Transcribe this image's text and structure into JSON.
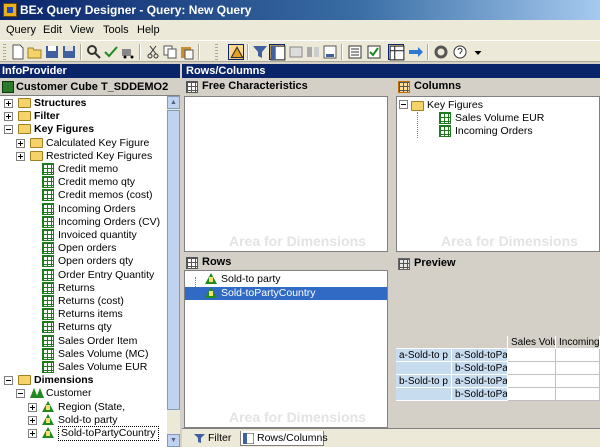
{
  "window": {
    "title": "BEx Query Designer - Query: New Query"
  },
  "menu": [
    "Query",
    "Edit",
    "View",
    "Tools",
    "Help"
  ],
  "toolbar": {
    "icons": [
      "new-icon",
      "open-icon",
      "save-icon",
      "print-icon",
      "cut-icon",
      "copy-icon",
      "paste-icon",
      "filter-icon",
      "rows-columns-icon",
      "properties-icon",
      "help-icon"
    ]
  },
  "left": {
    "header": "InfoProvider",
    "cube": "Customer Cube T_SDDEMO2",
    "tree": [
      {
        "label": "Structures",
        "kind": "folder",
        "bold": true,
        "expander": "plus"
      },
      {
        "label": "Filter",
        "kind": "folder",
        "bold": true,
        "expander": "plus"
      },
      {
        "label": "Key Figures",
        "kind": "folder",
        "bold": true,
        "expander": "minus"
      },
      {
        "label": "Calculated Key Figure",
        "kind": "folder",
        "expander": "plus"
      },
      {
        "label": "Restricted Key Figures",
        "kind": "folder",
        "expander": "plus"
      },
      {
        "label": "Credit memo",
        "kind": "kf"
      },
      {
        "label": "Credit memo qty",
        "kind": "kf"
      },
      {
        "label": "Credit memos (cost)",
        "kind": "kf"
      },
      {
        "label": "Incoming Orders",
        "kind": "kf"
      },
      {
        "label": "Incoming Orders (CV)",
        "kind": "kf"
      },
      {
        "label": "Invoiced quantity",
        "kind": "kf"
      },
      {
        "label": "Open orders",
        "kind": "kf"
      },
      {
        "label": "Open orders qty",
        "kind": "kf"
      },
      {
        "label": "Order Entry Quantity",
        "kind": "kf"
      },
      {
        "label": "Returns",
        "kind": "kf"
      },
      {
        "label": "Returns (cost)",
        "kind": "kf"
      },
      {
        "label": "Returns items",
        "kind": "kf"
      },
      {
        "label": "Returns qty",
        "kind": "kf"
      },
      {
        "label": "Sales Order Item",
        "kind": "kf"
      },
      {
        "label": "Sales Volume (MC)",
        "kind": "kf"
      },
      {
        "label": "Sales Volume EUR",
        "kind": "kf"
      },
      {
        "label": "Dimensions",
        "kind": "folder",
        "bold": true,
        "expander": "minus"
      },
      {
        "label": "Customer",
        "kind": "chars",
        "expander": "minus"
      },
      {
        "label": "Region (State,",
        "kind": "dim",
        "expander": "plus"
      },
      {
        "label": "Sold-to party",
        "kind": "dim",
        "expander": "plus"
      },
      {
        "label": "Sold-toPartyCountry",
        "kind": "dim",
        "expander": "plus",
        "selected": true
      }
    ]
  },
  "right": {
    "header": "Rows/Columns",
    "free_chars": {
      "title": "Free Characteristics",
      "watermark": "Area for Dimensions"
    },
    "columns": {
      "title": "Columns",
      "root": "Key Figures",
      "items": [
        "Sales Volume EUR",
        "Incoming Orders"
      ],
      "watermark": "Area for Dimensions"
    },
    "rows": {
      "title": "Rows",
      "items": [
        "Sold-to party",
        "Sold-toPartyCountry"
      ],
      "watermark": "Area for Dimensions"
    },
    "preview": {
      "title": "Preview",
      "col_headers": [
        "Sales Volu",
        "Incoming"
      ],
      "row_groups": [
        {
          "outer": "a-Sold-to p",
          "inner": [
            "a-Sold-toPa",
            "b-Sold-toPa"
          ]
        },
        {
          "outer": "b-Sold-to p",
          "inner": [
            "a-Sold-toPa",
            "b-Sold-toPa"
          ]
        }
      ]
    }
  },
  "tabs": [
    {
      "label": "Filter",
      "active": false
    },
    {
      "label": "Rows/Columns",
      "active": true
    }
  ]
}
